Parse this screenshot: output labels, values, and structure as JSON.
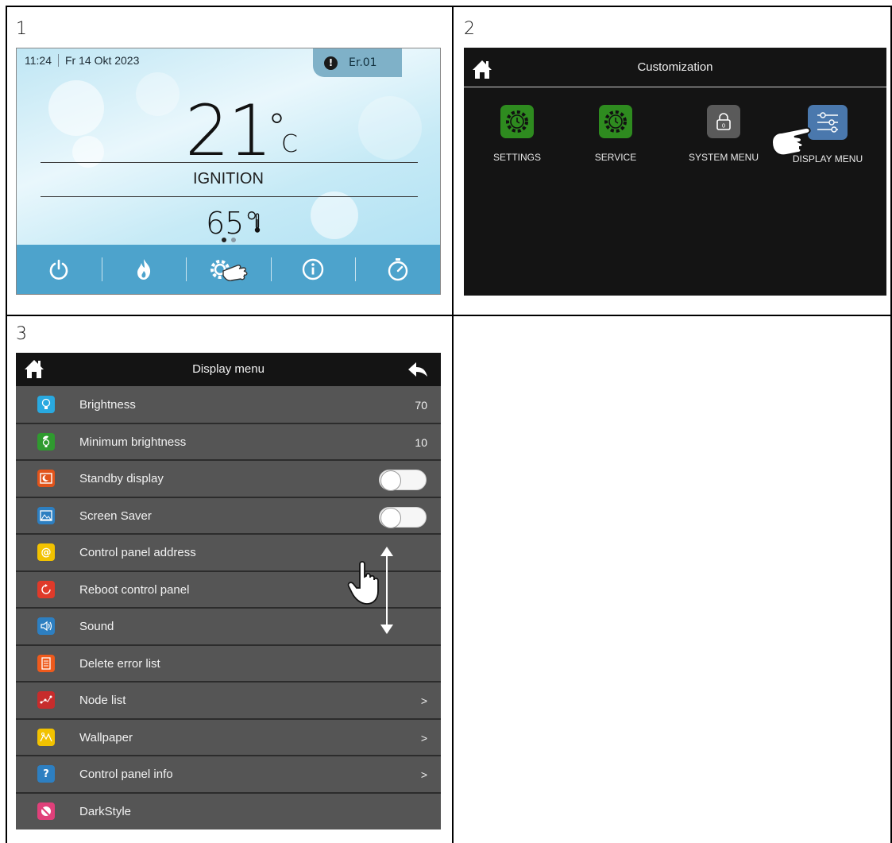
{
  "panel_numbers": [
    "1",
    "2",
    "3"
  ],
  "home": {
    "time": "11:24",
    "date": "Fr 14 Okt 2023",
    "error_code": "Er.01",
    "room_temp": "21",
    "room_temp_unit": "°",
    "room_temp_unit_c": "C",
    "state": "IGNITION",
    "water_temp": "65°",
    "nav_icons": [
      "power-icon",
      "flame-icon",
      "settings-gear-icon",
      "info-icon",
      "timer-icon"
    ]
  },
  "customization": {
    "title": "Customization",
    "tiles": [
      {
        "label": "SETTINGS",
        "icon": "gear-clock-icon",
        "color": "#2e8b1f"
      },
      {
        "label": "SERVICE",
        "icon": "gear-clock-icon",
        "color": "#2e8b1f"
      },
      {
        "label": "SYSTEM MENU",
        "icon": "lock-icon",
        "color": "#5a5a5a"
      },
      {
        "label": "DISPLAY MENU",
        "icon": "sliders-icon",
        "color": "#4a78ad"
      }
    ]
  },
  "display_menu": {
    "title": "Display menu",
    "items": [
      {
        "label": "Brightness",
        "value": "70",
        "icon": "bulb-icon",
        "color": "#29a9e0"
      },
      {
        "label": "Minimum brightness",
        "value": "10",
        "icon": "bulb-leaf-icon",
        "color": "#2f9a2f"
      },
      {
        "label": "Standby display",
        "toggle": "off",
        "icon": "moon-screen-icon",
        "color": "#e1541b"
      },
      {
        "label": "Screen Saver",
        "toggle": "off",
        "icon": "picture-icon",
        "color": "#2d7fc1"
      },
      {
        "label": "Control panel address",
        "icon": "at-icon",
        "color": "#f2c200"
      },
      {
        "label": "Reboot control panel",
        "icon": "reboot-icon",
        "color": "#e03a2a"
      },
      {
        "label": "Sound",
        "icon": "speaker-icon",
        "color": "#2d7fc1"
      },
      {
        "label": "Delete error list",
        "icon": "list-icon",
        "color": "#ef5a1c"
      },
      {
        "label": "Node list",
        "value": ">",
        "icon": "nodes-icon",
        "color": "#c72c2c"
      },
      {
        "label": "Wallpaper",
        "value": ">",
        "icon": "wallpaper-icon",
        "color": "#f2c200"
      },
      {
        "label": "Control panel info",
        "value": ">",
        "icon": "question-icon",
        "color": "#2d7fc1"
      },
      {
        "label": "DarkStyle",
        "icon": "darkstyle-icon",
        "color": "#e0407a"
      }
    ]
  }
}
